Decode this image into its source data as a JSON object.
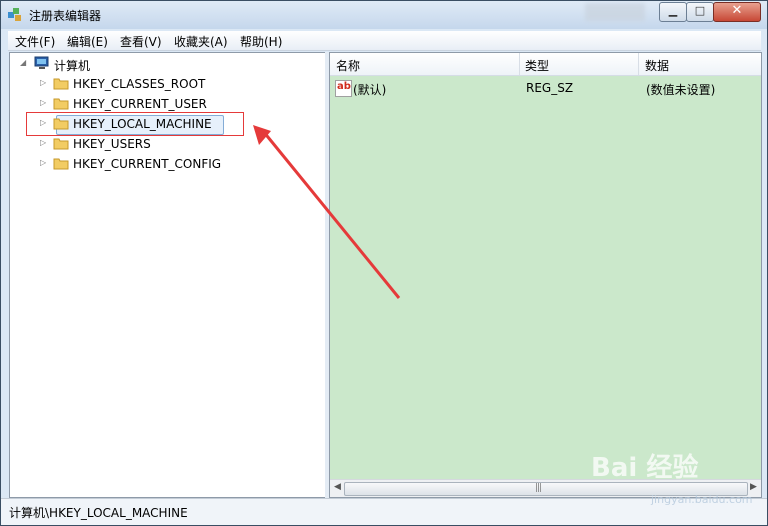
{
  "window": {
    "title": "注册表编辑器"
  },
  "menubar": {
    "items": [
      "文件(F)",
      "编辑(E)",
      "查看(V)",
      "收藏夹(A)",
      "帮助(H)"
    ]
  },
  "tree": {
    "root_label": "计算机",
    "nodes": [
      "HKEY_CLASSES_ROOT",
      "HKEY_CURRENT_USER",
      "HKEY_LOCAL_MACHINE",
      "HKEY_USERS",
      "HKEY_CURRENT_CONFIG"
    ],
    "selected_index": 2
  },
  "list": {
    "columns": [
      "名称",
      "类型",
      "数据"
    ],
    "rows": [
      {
        "name": "(默认)",
        "type": "REG_SZ",
        "data": "(数值未设置)"
      }
    ]
  },
  "statusbar": {
    "path": "计算机\\HKEY_LOCAL_MACHINE"
  },
  "watermark": {
    "main": "Bai 经验",
    "sub": "jingyan.baidu.com"
  },
  "colors": {
    "list_bg": "#cbe8cb",
    "highlight_rect": "#e53a3a",
    "arrow": "#e53a3a"
  },
  "icons": {
    "app": "regedit-icon",
    "computer": "computer-icon",
    "folder": "folder-icon",
    "value": "string-value-icon"
  }
}
